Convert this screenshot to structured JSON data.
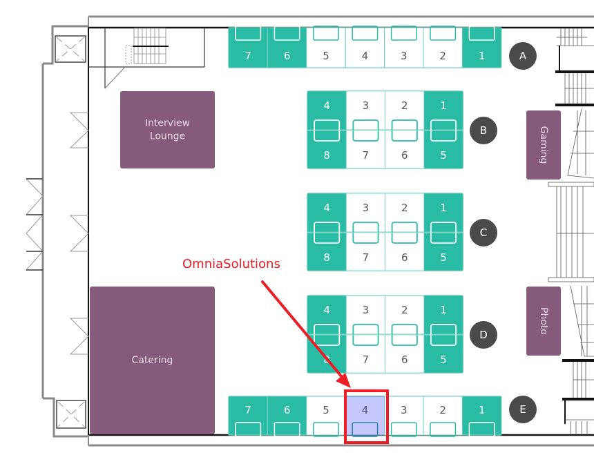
{
  "colors": {
    "booth_taken": "#2abba5",
    "booth_free": "#ffffff",
    "booth_border": "#6fcfbf",
    "booth_num_on_taken": "#ffffff",
    "booth_num_on_free": "#555555",
    "row_badge": "#4a4a4a",
    "room": "#855a7a",
    "highlight_fill": "#c5c7fb",
    "highlight_num": "#4a4f8a",
    "annotation": "#ee1c24",
    "wall": "#111111"
  },
  "rows": [
    {
      "label": "A",
      "layout": "single-top",
      "booths": [
        {
          "number": "7",
          "taken": true
        },
        {
          "number": "6",
          "taken": true
        },
        {
          "number": "5",
          "taken": false
        },
        {
          "number": "4",
          "taken": false
        },
        {
          "number": "3",
          "taken": false
        },
        {
          "number": "2",
          "taken": false
        },
        {
          "number": "1",
          "taken": true
        }
      ]
    },
    {
      "label": "B",
      "layout": "double",
      "columns": [
        {
          "top": "4",
          "bottom": "8",
          "taken": true
        },
        {
          "top": "3",
          "bottom": "7",
          "taken": false
        },
        {
          "top": "2",
          "bottom": "6",
          "taken": false
        },
        {
          "top": "1",
          "bottom": "5",
          "taken": true
        }
      ]
    },
    {
      "label": "C",
      "layout": "double",
      "columns": [
        {
          "top": "4",
          "bottom": "8",
          "taken": true
        },
        {
          "top": "3",
          "bottom": "7",
          "taken": false
        },
        {
          "top": "2",
          "bottom": "6",
          "taken": false
        },
        {
          "top": "1",
          "bottom": "5",
          "taken": true
        }
      ]
    },
    {
      "label": "D",
      "layout": "double",
      "columns": [
        {
          "top": "4",
          "bottom": "8",
          "taken": true
        },
        {
          "top": "3",
          "bottom": "7",
          "taken": false
        },
        {
          "top": "2",
          "bottom": "6",
          "taken": false
        },
        {
          "top": "1",
          "bottom": "5",
          "taken": true
        }
      ]
    },
    {
      "label": "E",
      "layout": "single-bottom",
      "booths": [
        {
          "number": "7",
          "taken": true
        },
        {
          "number": "6",
          "taken": true
        },
        {
          "number": "5",
          "taken": false
        },
        {
          "number": "4",
          "taken": false,
          "highlighted": true
        },
        {
          "number": "3",
          "taken": false
        },
        {
          "number": "2",
          "taken": false
        },
        {
          "number": "1",
          "taken": true
        }
      ]
    }
  ],
  "rooms": [
    {
      "id": "interview-lounge",
      "lines": [
        "Interview",
        "Lounge"
      ],
      "vertical": false
    },
    {
      "id": "catering",
      "lines": [
        "Catering"
      ],
      "vertical": false
    },
    {
      "id": "gaming",
      "lines": [
        "Gaming"
      ],
      "vertical": true
    },
    {
      "id": "photo",
      "lines": [
        "Photo"
      ],
      "vertical": true
    }
  ],
  "annotation": {
    "label": "OmniaSolutions",
    "target_row": "E",
    "target_booth": "4"
  }
}
